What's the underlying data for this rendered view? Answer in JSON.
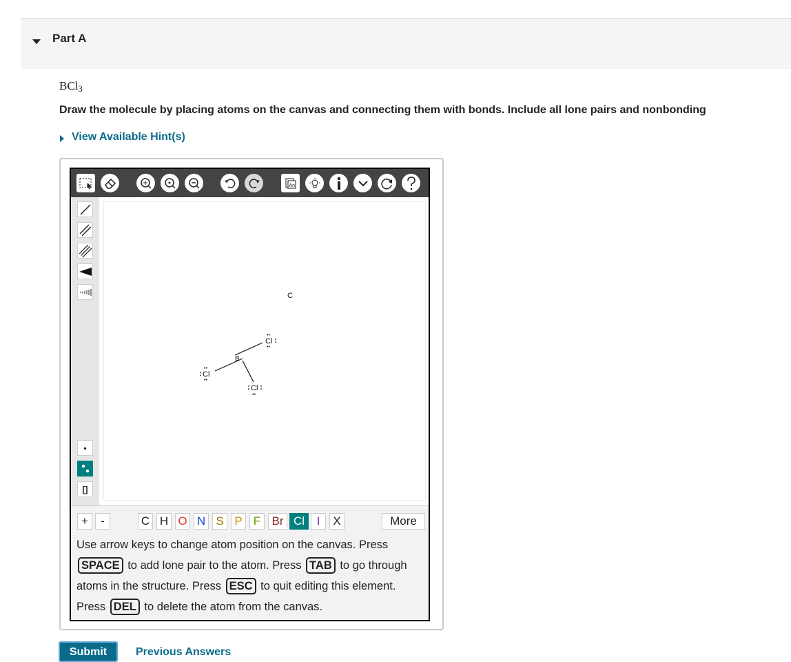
{
  "part": {
    "title": "Part A"
  },
  "question": {
    "formula": "BCl3",
    "instructions": "Draw the molecule by placing atoms on the canvas and connecting them with bonds. Include all lone pairs and nonbonding"
  },
  "hint_link": "View Available Hint(s)",
  "toolbar_icons": [
    "select-icon",
    "eraser-icon",
    "zoom-fit-icon",
    "zoom-in-icon",
    "zoom-out-icon",
    "undo-icon",
    "redo-icon",
    "template-icon",
    "lightbulb-icon",
    "info-icon",
    "chevron-down-icon",
    "reset-icon",
    "help-icon"
  ],
  "bond_tools": [
    "single-bond",
    "double-bond",
    "triple-bond",
    "wedge-bond",
    "hash-bond"
  ],
  "charge_buttons": [
    "+",
    "-"
  ],
  "atoms": [
    "C",
    "H",
    "O",
    "N",
    "S",
    "P",
    "F",
    "Br",
    "Cl",
    "I",
    "X"
  ],
  "selected_atom": "Cl",
  "atom_colors": {
    "C": "#222222",
    "H": "#222222",
    "O": "#e0322a",
    "N": "#1a3fd6",
    "S": "#9a7a00",
    "P": "#d08a00",
    "F": "#6a9a00",
    "Br": "#8a2a2a",
    "Cl": "#ffffff",
    "I": "#7a1fa0",
    "X": "#222222"
  },
  "more_button": "More",
  "side_tools": {
    "lone_pair_single": "•",
    "brackets": "[]"
  },
  "molecule": {
    "center": "B",
    "ligand": "Cl",
    "lone_pair_mark": "••",
    "stray_atom": "C"
  },
  "help": {
    "t1": "Use arrow keys to change atom position on the canvas. Press",
    "k1": "SPACE",
    "t2": "to add lone pair to the atom. Press",
    "k2": "TAB",
    "t3": "to go through atoms in the structure. Press",
    "k3": "ESC",
    "t4": "to quit editing this element. Press",
    "k4": "DEL",
    "t5": "to delete the atom from the canvas."
  },
  "submit": "Submit",
  "previous_answers": "Previous Answers",
  "colors": {
    "accent": "#0a6b8a",
    "teal": "#007f7f"
  }
}
